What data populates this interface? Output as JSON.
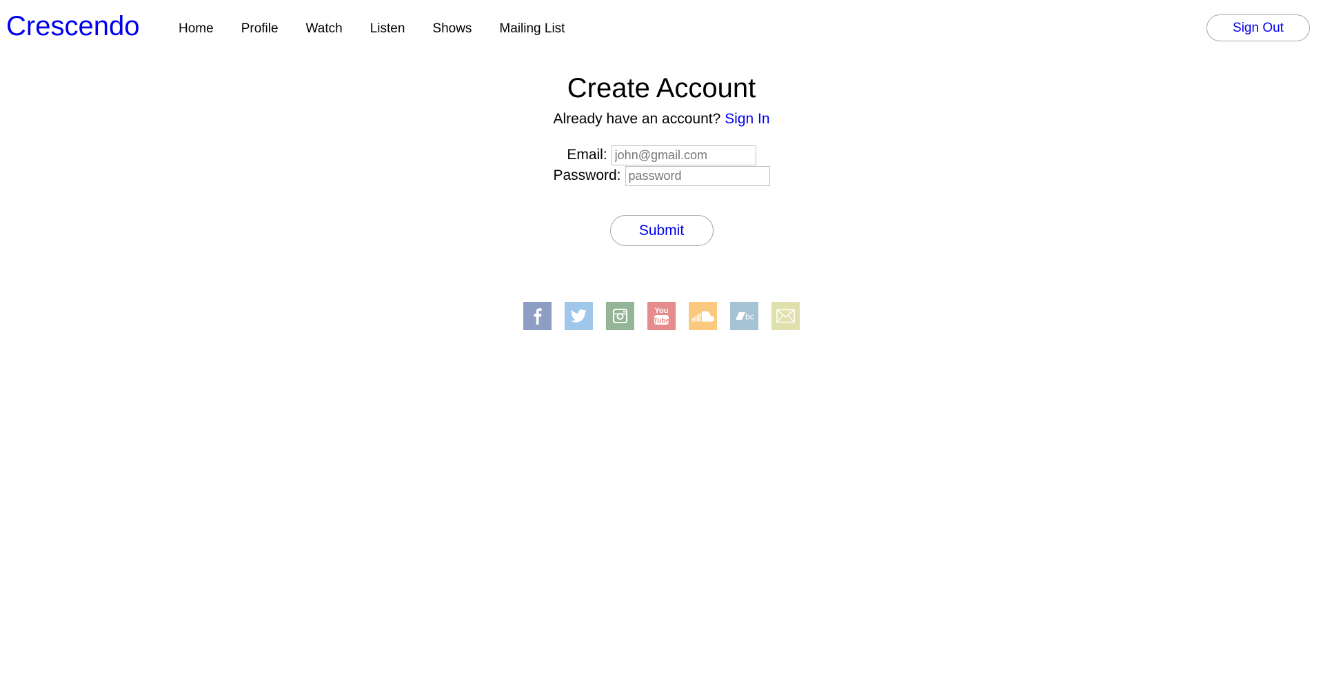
{
  "header": {
    "brand": "Crescendo",
    "nav": [
      {
        "label": "Home"
      },
      {
        "label": "Profile"
      },
      {
        "label": "Watch"
      },
      {
        "label": "Listen"
      },
      {
        "label": "Shows"
      },
      {
        "label": "Mailing List"
      }
    ],
    "sign_out_label": "Sign Out"
  },
  "main": {
    "title": "Create Account",
    "subtitle_text": "Already have an account?",
    "sign_in_link": "Sign In",
    "form": {
      "email_label": "Email:",
      "email_placeholder": "john@gmail.com",
      "email_value": "",
      "password_label": "Password:",
      "password_placeholder": "password",
      "password_value": "",
      "submit_label": "Submit"
    }
  },
  "social": [
    {
      "icon": "facebook-icon",
      "color": "#8e9dc4"
    },
    {
      "icon": "twitter-icon",
      "color": "#9fc7ea"
    },
    {
      "icon": "instagram-icon",
      "color": "#94b597"
    },
    {
      "icon": "youtube-icon",
      "color": "#e78c8d",
      "text_top": "You",
      "text_bottom": "Tube"
    },
    {
      "icon": "soundcloud-icon",
      "color": "#fbc97e"
    },
    {
      "icon": "bandcamp-icon",
      "color": "#a6c3d6",
      "text": "bc"
    },
    {
      "icon": "email-icon",
      "color": "#dfe0ac"
    }
  ],
  "colors": {
    "brand": "#0000ee",
    "link": "#0000ee",
    "button_border": "#a6a6a6"
  }
}
